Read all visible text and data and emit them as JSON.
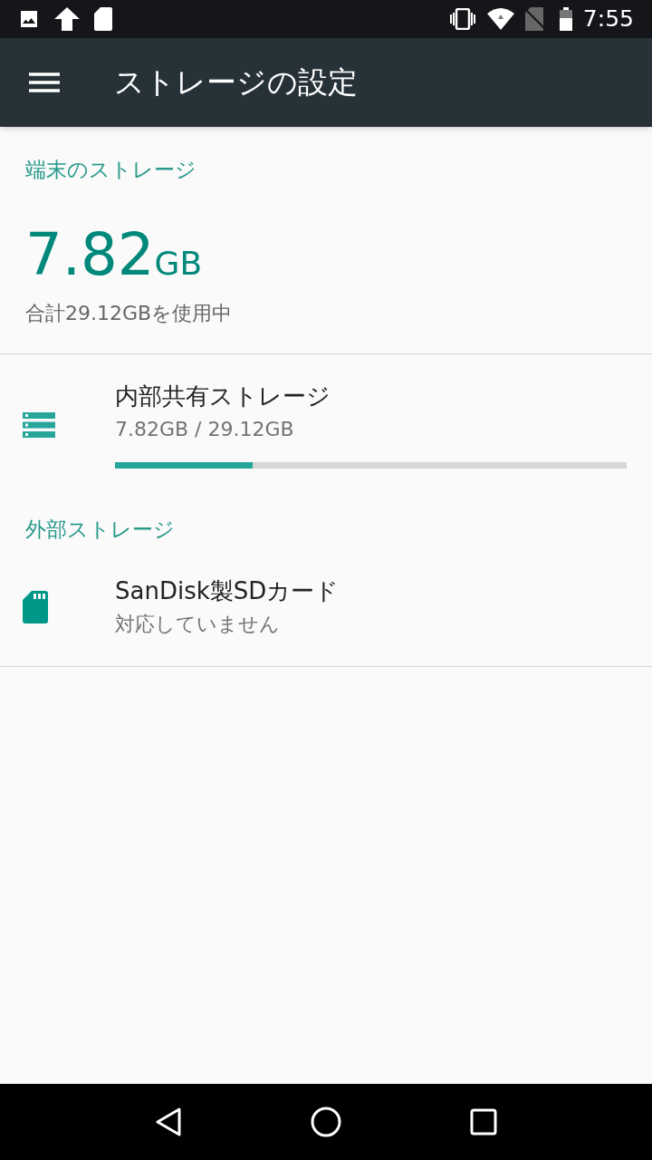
{
  "status_bar": {
    "time": "7:55"
  },
  "app_bar": {
    "title": "ストレージの設定"
  },
  "summary": {
    "header": "端末のストレージ",
    "value": "7.82",
    "unit": "GB",
    "caption": "合計29.12GBを使用中"
  },
  "sections": [
    {
      "items": [
        {
          "kind": "internal",
          "title": "内部共有ストレージ",
          "subtitle": "7.82GB / 29.12GB",
          "level": 0.2686
        }
      ]
    },
    {
      "header": "外部ストレージ",
      "items": [
        {
          "kind": "sd",
          "title": "SanDisk製SDカード",
          "subtitle": "対応していません"
        }
      ]
    }
  ]
}
